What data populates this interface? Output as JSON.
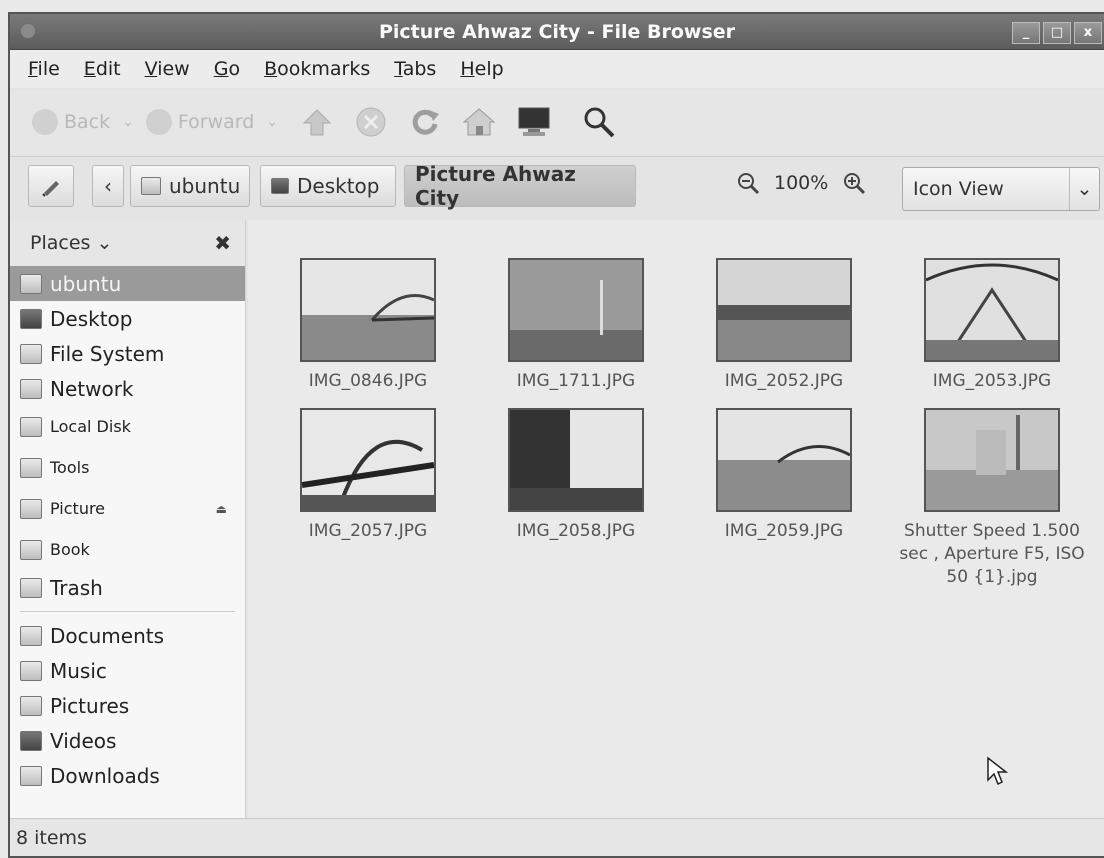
{
  "window": {
    "title": "Picture Ahwaz City - File Browser",
    "controls": [
      "_",
      "□",
      "x"
    ]
  },
  "menu": [
    "File",
    "Edit",
    "View",
    "Go",
    "Bookmarks",
    "Tabs",
    "Help"
  ],
  "toolbar": {
    "back": "Back",
    "forward": "Forward"
  },
  "location": {
    "crumbs": [
      "ubuntu",
      "Desktop",
      "Picture Ahwaz City"
    ],
    "zoom": "100%",
    "view_mode": "Icon View"
  },
  "sidebar": {
    "header": "Places",
    "places": [
      {
        "label": "ubuntu",
        "icon": "home-folder-icon",
        "selected": true
      },
      {
        "label": "Desktop",
        "icon": "desktop-icon"
      },
      {
        "label": "File System",
        "icon": "drive-icon"
      },
      {
        "label": "Network",
        "icon": "network-icon"
      },
      {
        "label": "Local Disk",
        "icon": "drive-icon"
      },
      {
        "label": "Tools",
        "icon": "drive-icon"
      },
      {
        "label": "Picture",
        "icon": "drive-icon",
        "eject": true
      },
      {
        "label": "Book",
        "icon": "drive-icon"
      },
      {
        "label": "Trash",
        "icon": "trash-icon"
      }
    ],
    "bookmarks": [
      {
        "label": "Documents",
        "icon": "documents-folder-icon"
      },
      {
        "label": "Music",
        "icon": "music-folder-icon"
      },
      {
        "label": "Pictures",
        "icon": "pictures-folder-icon"
      },
      {
        "label": "Videos",
        "icon": "videos-folder-icon"
      },
      {
        "label": "Downloads",
        "icon": "downloads-folder-icon"
      }
    ]
  },
  "files": [
    {
      "name": "IMG_0846.JPG"
    },
    {
      "name": "IMG_1711.JPG"
    },
    {
      "name": "IMG_2052.JPG"
    },
    {
      "name": "IMG_2053.JPG"
    },
    {
      "name": "IMG_2057.JPG"
    },
    {
      "name": "IMG_2058.JPG"
    },
    {
      "name": "IMG_2059.JPG"
    },
    {
      "name": "Shutter Speed 1.500 sec , Aperture F5, ISO 50 {1}.jpg"
    }
  ],
  "status": "8 items"
}
